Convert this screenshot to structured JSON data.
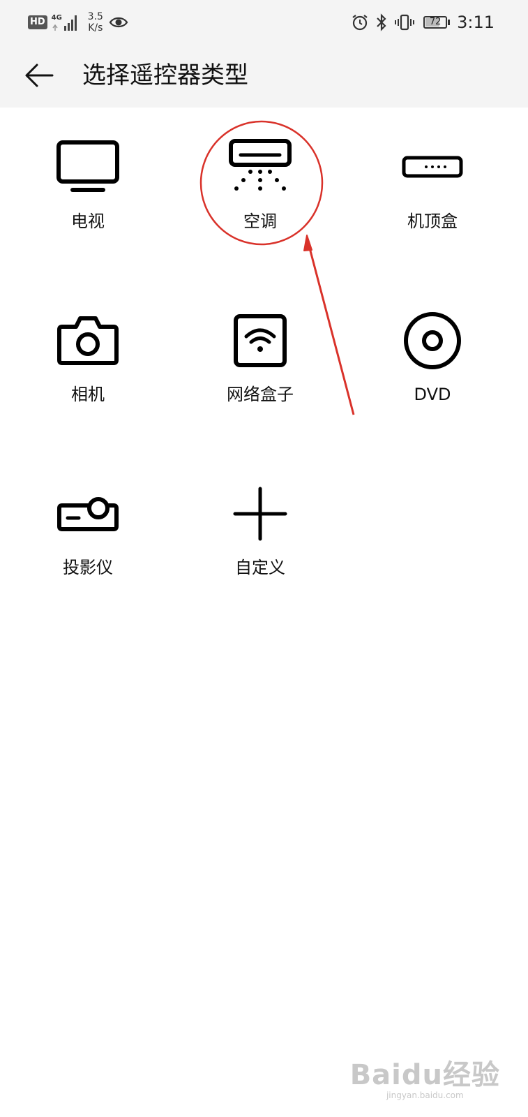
{
  "status_bar": {
    "hd": "HD",
    "network": "4G",
    "speed_value": "3.5",
    "speed_unit": "K/s",
    "battery": "72",
    "battery_level": 0.72,
    "time": "3:11",
    "icons": [
      "eye-icon",
      "alarm-icon",
      "bluetooth-icon",
      "vibrate-icon"
    ]
  },
  "header": {
    "title": "选择遥控器类型",
    "back_icon": "arrow-left-icon"
  },
  "remote_types": [
    {
      "key": "tv",
      "label": "电视",
      "icon": "tv-icon"
    },
    {
      "key": "ac",
      "label": "空调",
      "icon": "air-conditioner-icon"
    },
    {
      "key": "stb",
      "label": "机顶盒",
      "icon": "set-top-box-icon"
    },
    {
      "key": "camera",
      "label": "相机",
      "icon": "camera-icon"
    },
    {
      "key": "netbox",
      "label": "网络盒子",
      "icon": "wifi-box-icon"
    },
    {
      "key": "dvd",
      "label": "DVD",
      "icon": "disc-icon"
    },
    {
      "key": "projector",
      "label": "投影仪",
      "icon": "projector-icon"
    },
    {
      "key": "custom",
      "label": "自定义",
      "icon": "plus-icon"
    }
  ],
  "annotation": {
    "color": "#d9322a",
    "highlighted": "ac"
  },
  "watermark": {
    "main": "Baidu经验",
    "sub": "jingyan.baidu.com"
  }
}
